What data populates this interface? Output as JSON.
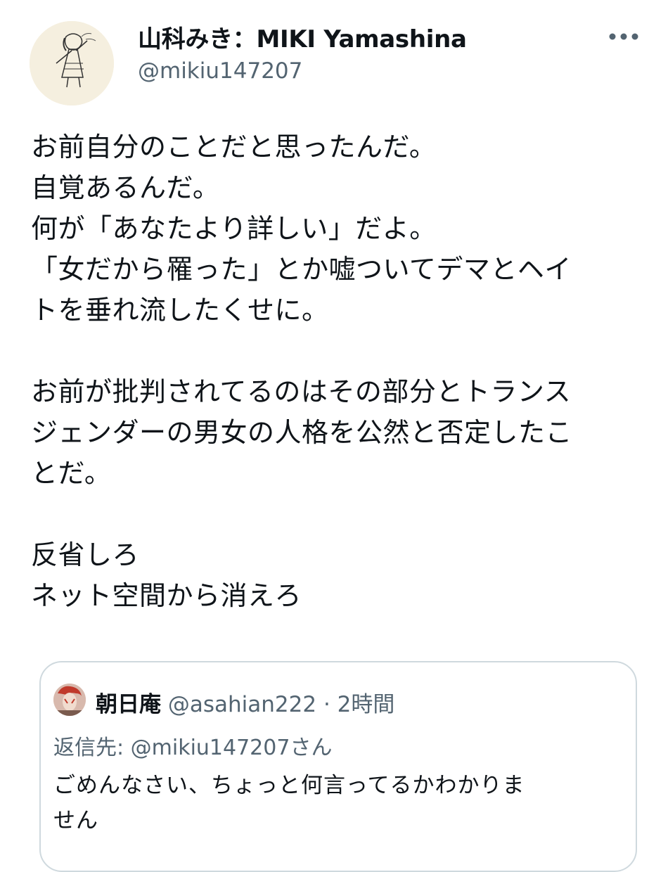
{
  "author": {
    "display_name": "山科みき：MIKI Yamashina",
    "handle": "@mikiu147207"
  },
  "tweet": {
    "lines": [
      "お前自分のことだと思ったんだ。",
      "自覚あるんだ。",
      "何が「あなたより詳しい」だよ。",
      "「女だから罹った」とか嘘ついてデマとヘイ",
      "トを垂れ流したくせに。",
      "",
      "お前が批判されてるのはその部分とトランス",
      "ジェンダーの男女の人格を公然と否定したこ",
      "とだ。",
      "",
      "反省しろ",
      "ネット空間から消えろ"
    ]
  },
  "quoted_tweet": {
    "display_name": "朝日庵",
    "handle": "@asahian222",
    "separator": "·",
    "time": "2時間",
    "reply_to": "返信先: @mikiu147207さん",
    "text_lines": [
      "ごめんなさい、ちょっと何言ってるかわかりま",
      "せん"
    ]
  },
  "icons": {
    "more": "more-horizontal-icon"
  },
  "colors": {
    "text": "#0f1419",
    "secondary": "#536471",
    "border": "#cfd9de"
  }
}
